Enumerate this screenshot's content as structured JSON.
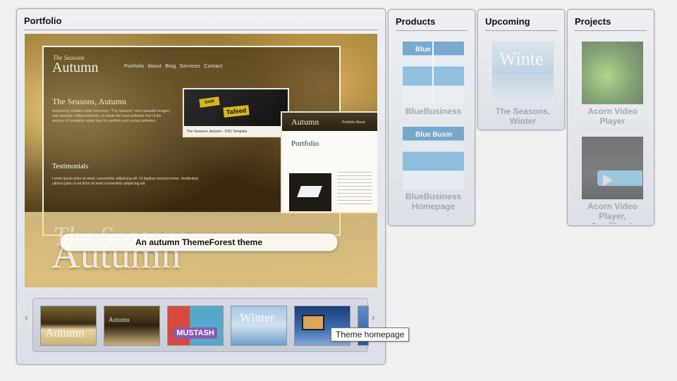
{
  "portfolio": {
    "title": "Portfolio",
    "showcase": {
      "site_logo_small": "The Seasons",
      "site_logo": "Autumn",
      "site_nav": "Portfolio About Blog Services Contact",
      "site_heading": "The Seasons, Autumn",
      "site_para": "Inspired by Vivaldi's violin concertos, \"The Seasons\" were beautiful imagery and carefully crafted elements, to create the most authentic feel of the season. It's probably suited best for portfolio and product websites.",
      "testimonials": "Testimonials",
      "quote": "Lorem ipsum dolor sit amet, consectetur adipiscing elit. Ut dapibus tincidunt tortor. Vestibulum ultrices justo ut vel dolor sit amet consectetur adipiscing elit.",
      "card_tag": "Tafeed",
      "card_tag2": "Gold",
      "card_caption": "The Seasons, Autumn - PSD Template",
      "phone_logo": "Autumn",
      "phone_nav": "Portfolio About",
      "phone_title": "Portfolio",
      "big_top": "The Seasons",
      "big_word": "Autumn"
    },
    "caption": "An autumn ThemeForest theme",
    "thumbnails": {
      "prev_arrow": "‹",
      "next_arrow": "›",
      "t1_label": "Autumn",
      "t2_label": "Autumn",
      "t3_label": "MUSTASH",
      "t4_label": "Winter"
    },
    "tooltip": "Theme homepage"
  },
  "products": {
    "title": "Products",
    "items": [
      {
        "caption": "BlueBusiness",
        "pic_text": "Blue"
      },
      {
        "caption": "BlueBusiness Homepage",
        "pic_text": "Blue Busin"
      }
    ]
  },
  "upcoming": {
    "title": "Upcoming",
    "items": [
      {
        "caption": "The Seasons, Winter",
        "pic_text": "Winte"
      }
    ]
  },
  "projects": {
    "title": "Projects",
    "items": [
      {
        "caption": "Acorn Video Player"
      },
      {
        "caption": "Acorn Video Player, Smallbook"
      }
    ]
  }
}
